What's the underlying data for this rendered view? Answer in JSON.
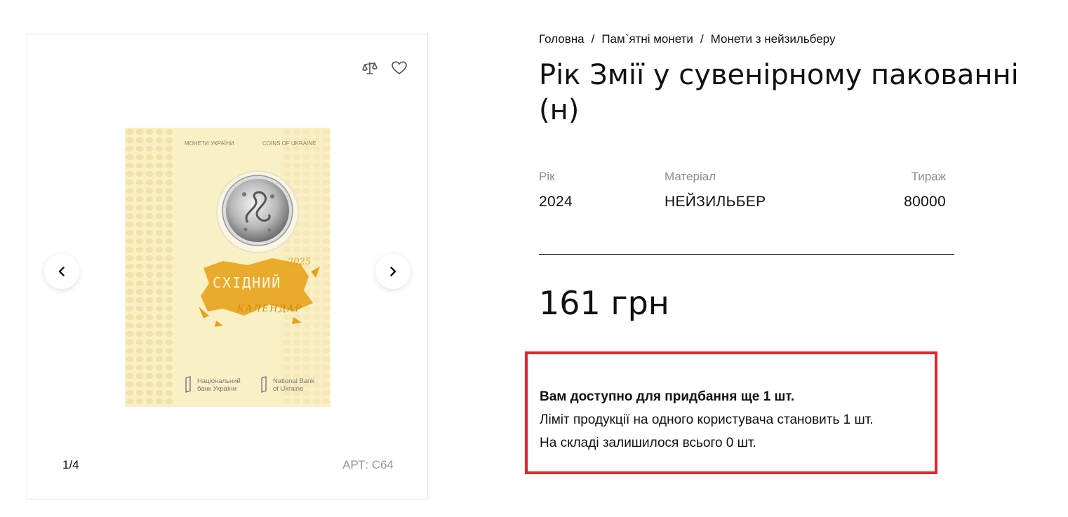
{
  "breadcrumb": {
    "home": "Головна",
    "category": "Пам`ятні монети",
    "subcategory": "Монети з нейзильберу",
    "separator": "/"
  },
  "product": {
    "title": "Рік Змії у сувенірному пакованні (н)",
    "price": "161 грн",
    "specs": {
      "year_label": "Рік",
      "year_value": "2024",
      "material_label": "Матеріал",
      "material_value": "НЕЙЗИЛЬБЕР",
      "mintage_label": "Тираж",
      "mintage_value": "80000"
    }
  },
  "gallery": {
    "counter": "1/4",
    "sku": "АРТ: С64",
    "icons": {
      "compare": "scales-icon",
      "favorite": "heart-icon",
      "prev": "chevron-left-icon",
      "next": "chevron-right-icon"
    },
    "packaging": {
      "top_left": "МОНЕТИ УКРАЇНИ",
      "top_right": "COINS OF UKRAINE",
      "year": "2025",
      "logo_title": "СХІДНИЙ",
      "logo_subtitle": "КАЛЕНДАР",
      "bank_ua_line1": "Національний",
      "bank_ua_line2": "банк України",
      "bank_en_line1": "National Bank",
      "bank_en_line2": "of Ukraine"
    }
  },
  "notice": {
    "available": "Вам доступно для придбання ще 1 шт.",
    "limit": "Ліміт продукції на одного користувача становить 1 шт.",
    "stock": "На складі залишилося всього 0 шт."
  },
  "colors": {
    "notice_border": "#e1262d",
    "packaging_bg": "#faf0c6",
    "packaging_accent": "#e8a21a"
  }
}
